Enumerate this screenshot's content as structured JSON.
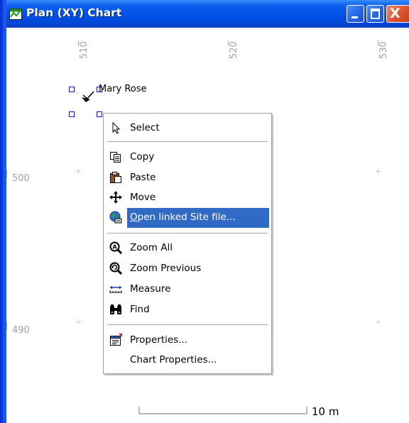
{
  "window": {
    "title": "Plan (XY) Chart",
    "buttons": {
      "minimize": "",
      "maximize": "",
      "close": "X"
    }
  },
  "chart": {
    "x_ticks": [
      "510",
      "520",
      "530"
    ],
    "y_ticks": [
      "500",
      "490"
    ],
    "site": {
      "label": "Mary Rose"
    },
    "scale_bar": {
      "label": "10 m"
    }
  },
  "context_menu": {
    "items": [
      {
        "label": "Select",
        "icon": "cursor-arrow-icon"
      },
      {
        "label": "Copy",
        "icon": "copy-icon"
      },
      {
        "label": "Paste",
        "icon": "paste-icon"
      },
      {
        "label": "Move",
        "icon": "move-arrows-icon"
      },
      {
        "label": "Open linked Site file...",
        "icon": "globe-link-icon",
        "highlighted": true
      },
      {
        "label": "Zoom All",
        "icon": "zoom-all-icon"
      },
      {
        "label": "Zoom Previous",
        "icon": "zoom-previous-icon"
      },
      {
        "label": "Measure",
        "icon": "measure-icon"
      },
      {
        "label": "Find",
        "icon": "binoculars-icon"
      },
      {
        "label": "Properties...",
        "icon": "properties-icon"
      },
      {
        "label": "Chart Properties...",
        "icon": ""
      }
    ]
  },
  "colors": {
    "titlebar": "#0050e6",
    "highlight": "#316ac5",
    "selection_handle": "#1010d0",
    "grid_text": "#a0a0a0"
  }
}
